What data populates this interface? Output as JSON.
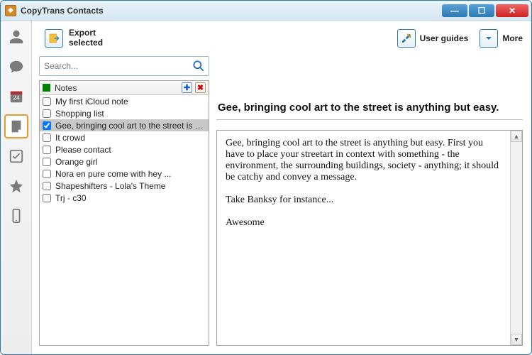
{
  "window": {
    "title": "CopyTrans Contacts"
  },
  "toolbar": {
    "export_line1": "Export",
    "export_line2": "selected",
    "user_guides": "User guides",
    "more": "More"
  },
  "search": {
    "placeholder": "Search..."
  },
  "list": {
    "header": "Notes",
    "items": [
      {
        "label": "My first iCloud note",
        "checked": false
      },
      {
        "label": "Shopping list",
        "checked": false
      },
      {
        "label": "Gee, bringing cool art to the street is a...",
        "checked": true,
        "selected": true
      },
      {
        "label": "It crowd",
        "checked": false
      },
      {
        "label": "Please contact",
        "checked": false
      },
      {
        "label": "Orange girl",
        "checked": false
      },
      {
        "label": "Nora en pure come with hey ...",
        "checked": false
      },
      {
        "label": "Shapeshifters - Lola's Theme",
        "checked": false
      },
      {
        "label": "Trj - c30",
        "checked": false
      }
    ]
  },
  "note": {
    "title": "Gee, bringing cool art to the street is anything but easy.",
    "body": "Gee, bringing cool art to the street is anything but easy. First you have to place your streetart in context with something - the environment, the surrounding buildings, society - anything; it should be catchy and convey a message.\n\nTake Banksy for instance...\n\nAwesome"
  }
}
